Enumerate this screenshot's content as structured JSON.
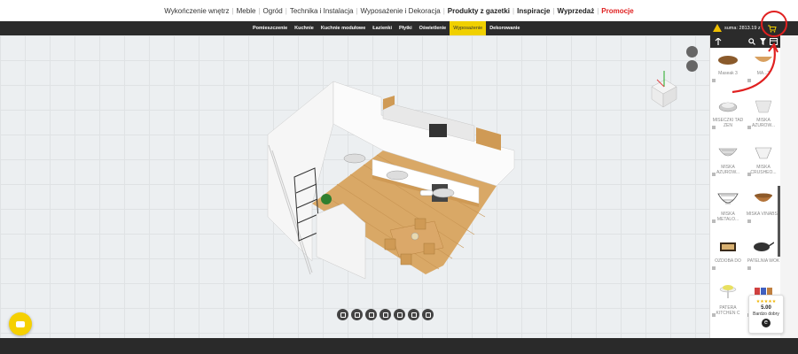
{
  "topnav": {
    "items": [
      {
        "label": "Wykończenie wnętrz",
        "style": "normal"
      },
      {
        "label": "Meble",
        "style": "normal"
      },
      {
        "label": "Ogród",
        "style": "normal"
      },
      {
        "label": "Technika i Instalacja",
        "style": "normal"
      },
      {
        "label": "Wyposażenie i Dekoracja",
        "style": "normal"
      },
      {
        "label": "Produkty z gazetki",
        "style": "bold"
      },
      {
        "label": "Inspiracje",
        "style": "bold"
      },
      {
        "label": "Wyprzedaż",
        "style": "bold"
      },
      {
        "label": "Promocje",
        "style": "promo"
      }
    ]
  },
  "subnav": {
    "categories": [
      {
        "label": "Pomieszczenie",
        "active": false
      },
      {
        "label": "Kuchnie",
        "active": false
      },
      {
        "label": "Kuchnie modułowe",
        "active": false
      },
      {
        "label": "Łazienki",
        "active": false
      },
      {
        "label": "Płytki",
        "active": false
      },
      {
        "label": "Oświetlenie",
        "active": false
      },
      {
        "label": "Wyposażenie",
        "active": true
      },
      {
        "label": "Dekorowanie",
        "active": false
      }
    ],
    "total_text": "suma: 2813.19 z",
    "cart_icon": "cart-icon"
  },
  "panel": {
    "head_icons": [
      "up-arrow-icon",
      "search-icon",
      "filter-icon",
      "stack-icon"
    ],
    "rows": [
      [
        {
          "label": "Maseak 3",
          "thumb": "plate"
        },
        {
          "label": "MA...3",
          "thumb": "bowl-wood"
        }
      ],
      [
        {
          "label": "MISECZKI TAD ZEN",
          "thumb": "bowls-white"
        },
        {
          "label": "MISKA AZUROW...",
          "thumb": "bowl-glass"
        }
      ],
      [
        {
          "label": "MISKA AZUROW...",
          "thumb": "bowl-lattice"
        },
        {
          "label": "MISKA CRUSHEO...",
          "thumb": "bowl-white"
        }
      ],
      [
        {
          "label": "MISKA METALO...",
          "thumb": "bowl-wire"
        },
        {
          "label": "MISKA VINABSE",
          "thumb": "bowl-brown"
        }
      ],
      [
        {
          "label": "OZDOBA DO",
          "thumb": "tray"
        },
        {
          "label": "PATELNIA WOK",
          "thumb": "wok"
        }
      ],
      [
        {
          "label": "PATERA KITCHEN C",
          "thumb": "cakestand"
        },
        {
          "label": "",
          "thumb": "books"
        }
      ]
    ]
  },
  "rating": {
    "stars": "★★★★★",
    "score": "5.00",
    "label": "Bardzo dobry",
    "logo_letter": "e"
  },
  "toolbar": {
    "icons": [
      "view-2d-icon",
      "view-3d-icon",
      "zoom-in-icon",
      "zoom-out-icon",
      "cut-icon",
      "copy-icon",
      "save-icon"
    ]
  },
  "colors": {
    "accent_yellow": "#f0d000",
    "dark_bar": "#2b2b2b",
    "promo_red": "#e02020",
    "annotation_red": "#e02020"
  }
}
